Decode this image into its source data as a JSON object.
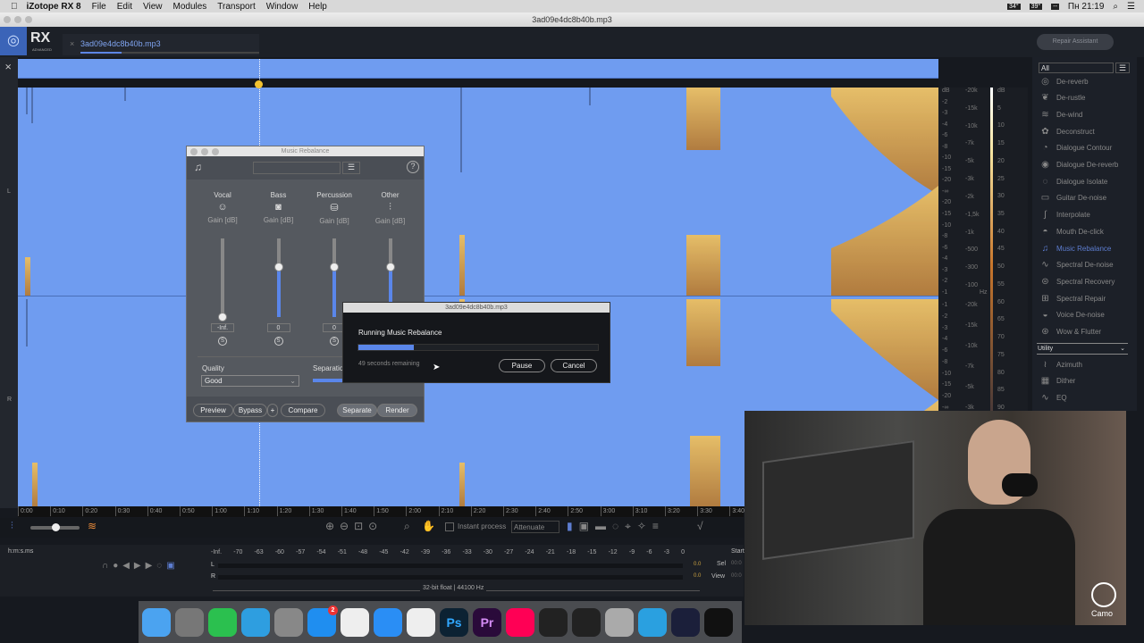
{
  "menubar": {
    "app": "iZotope RX 8",
    "items": [
      "File",
      "Edit",
      "View",
      "Modules",
      "Transport",
      "Window",
      "Help"
    ],
    "status": {
      "temp1": "34°",
      "temp2": "39°",
      "temp3": "--",
      "clock": "Пн 21:19"
    }
  },
  "window": {
    "title": "3ad09e4dc8b40b.mp3"
  },
  "header": {
    "logo": "RX",
    "logo_sub": "ADVANCED",
    "tab": "3ad09e4dc8b40b.mp3",
    "tab_progress": 0.23,
    "repair_assistant": "Repair Assistant"
  },
  "channels": {
    "left": "L",
    "right": "R"
  },
  "scale": {
    "amp_top": [
      "dB",
      "-2",
      "-3",
      "-4",
      "-6",
      "-8",
      "-10",
      "-15",
      "-20",
      "-∞",
      "-20",
      "-15",
      "-10",
      "-8",
      "-6",
      "-4",
      "-3",
      "-2",
      "-1"
    ],
    "amp_bottom": [
      "-1",
      "-2",
      "-3",
      "-4",
      "-6",
      "-8",
      "-10",
      "-15",
      "-20",
      "-∞"
    ],
    "freq_top": [
      "-20k",
      "-15k",
      "-10k",
      "-7k",
      "-5k",
      "-3k",
      "-2k",
      "-1,5k",
      "-1k",
      "-500",
      "-300",
      "-100"
    ],
    "freq_bottom": [
      "-20k",
      "-15k",
      "-10k",
      "-7k",
      "-5k",
      "-3k"
    ],
    "hz": "Hz",
    "meter": [
      "dB",
      "5",
      "10",
      "15",
      "20",
      "25",
      "30",
      "35",
      "40",
      "45",
      "50",
      "55",
      "60",
      "65",
      "70",
      "75",
      "80",
      "85",
      "90"
    ]
  },
  "module_panel": {
    "filter": "All",
    "items": [
      {
        "icon": "◎",
        "label": "De-reverb"
      },
      {
        "icon": "❦",
        "label": "De-rustle"
      },
      {
        "icon": "≋",
        "label": "De-wind"
      },
      {
        "icon": "✿",
        "label": "Deconstruct"
      },
      {
        "icon": "◔",
        "label": "Dialogue Contour"
      },
      {
        "icon": "◉",
        "label": "Dialogue De-reverb"
      },
      {
        "icon": "◌",
        "label": "Dialogue Isolate"
      },
      {
        "icon": "▭",
        "label": "Guitar De-noise"
      },
      {
        "icon": "∫",
        "label": "Interpolate"
      },
      {
        "icon": "◓",
        "label": "Mouth De-click"
      },
      {
        "icon": "♫",
        "label": "Music Rebalance",
        "active": true
      },
      {
        "icon": "∿",
        "label": "Spectral De-noise"
      },
      {
        "icon": "⊜",
        "label": "Spectral Recovery"
      },
      {
        "icon": "⊞",
        "label": "Spectral Repair"
      },
      {
        "icon": "◒",
        "label": "Voice De-noise"
      },
      {
        "icon": "⊛",
        "label": "Wow & Flutter"
      }
    ],
    "section": "Utility",
    "utility": [
      {
        "icon": "≀",
        "label": "Azimuth"
      },
      {
        "icon": "▦",
        "label": "Dither"
      },
      {
        "icon": "∿",
        "label": "EQ"
      }
    ]
  },
  "ruler": [
    "0:00",
    "0:10",
    "0:20",
    "0:30",
    "0:40",
    "0:50",
    "1:00",
    "1:10",
    "1:20",
    "1:30",
    "1:40",
    "1:50",
    "2:00",
    "2:10",
    "2:20",
    "2:30",
    "2:40",
    "2:50",
    "3:00",
    "3:10",
    "3:20",
    "3:30",
    "3:40"
  ],
  "toolbar": {
    "instant_process": "Instant process",
    "mode": "Attenuate"
  },
  "bottom": {
    "time_format": "h:m:s.ms",
    "meter_scale": [
      "-Inf.",
      "-70",
      "-63",
      "-60",
      "-57",
      "-54",
      "-51",
      "-48",
      "-45",
      "-42",
      "-39",
      "-36",
      "-33",
      "-30",
      "-27",
      "-24",
      "-21",
      "-18",
      "-15",
      "-12",
      "-9",
      "-6",
      "-3",
      "0"
    ],
    "l_peak": "0.0",
    "r_peak": "0.0",
    "format": "32-bit float | 44100 Hz",
    "start": "Start",
    "sel": "Sel",
    "view": "View",
    "sel_val": "00:0",
    "view_val": "00:0"
  },
  "music_rebalance": {
    "title": "Music Rebalance",
    "channels": [
      {
        "name": "Vocal",
        "gain_label": "Gain [dB]",
        "value": "-Inf.",
        "level": 0
      },
      {
        "name": "Bass",
        "gain_label": "Gain [dB]",
        "value": "0",
        "level": 0.64
      },
      {
        "name": "Percussion",
        "gain_label": "Gain [dB]",
        "value": "0",
        "level": 0.64
      },
      {
        "name": "Other",
        "gain_label": "Gain [dB]",
        "value": "0",
        "level": 0.64
      }
    ],
    "quality_label": "Quality",
    "quality": "Good",
    "separation_label": "Separation",
    "buttons": {
      "preview": "Preview",
      "bypass": "Bypass",
      "plus": "+",
      "compare": "Compare",
      "separate": "Separate",
      "render": "Render"
    }
  },
  "progress": {
    "title": "3ad09e4dc8b40b.mp3",
    "message": "Running Music Rebalance",
    "progress": 0.23,
    "remaining": "49 seconds remaining",
    "pause": "Pause",
    "cancel": "Cancel"
  },
  "dock": [
    {
      "name": "Finder",
      "color": "#4ba3f0"
    },
    {
      "name": "Disk Utility",
      "color": "#777"
    },
    {
      "name": "WhatsApp",
      "color": "#2bc04f"
    },
    {
      "name": "Telegram",
      "color": "#2e9ee0"
    },
    {
      "name": "Launchpad",
      "color": "#888"
    },
    {
      "name": "App Store",
      "color": "#1f8ef0",
      "badge": "2"
    },
    {
      "name": "Cubase",
      "color": "#eee"
    },
    {
      "name": "Safari",
      "color": "#2a8ef5"
    },
    {
      "name": "Chrome",
      "color": "#eee"
    },
    {
      "name": "Ps",
      "color": "#0c2233",
      "text": "Ps"
    },
    {
      "name": "Pr",
      "color": "#2a0a3a",
      "text": "Pr"
    },
    {
      "name": "Music",
      "color": "#f05"
    },
    {
      "name": "UAD Console",
      "color": "#222"
    },
    {
      "name": "UAD Meter",
      "color": "#222"
    },
    {
      "name": "Photo Slideshow",
      "color": "#aaa"
    },
    {
      "name": "Sourcetree",
      "color": "#2aa0e0"
    },
    {
      "name": "OBS",
      "color": "#1b1f3a"
    },
    {
      "name": "Ornament",
      "color": "#111"
    }
  ],
  "webcam": {
    "watermark": "Camo"
  }
}
